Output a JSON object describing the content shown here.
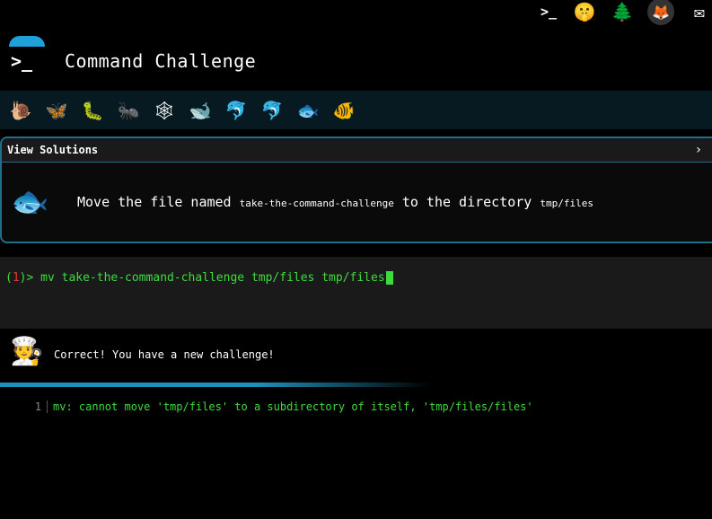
{
  "header": {
    "title": "Command Challenge",
    "top_icons": [
      "prompt-icon",
      "shushing-face-icon",
      "tree-icon",
      "gitlab-icon",
      "mail-icon"
    ],
    "prompt_glyph": ">_"
  },
  "levels": {
    "items": [
      "snail",
      "butterfly",
      "caterpillar",
      "ant",
      "spider-web",
      "whale",
      "dolphin-blue",
      "dolphin-grey",
      "fish",
      "tropical-fish"
    ],
    "active_index": 8
  },
  "solutions_panel": {
    "label": "View Solutions",
    "chevron": "›"
  },
  "challenge": {
    "text_1": "Move the file named ",
    "code_1": "take-the-command-challenge",
    "text_2": " to the directory ",
    "code_2": "tmp/files"
  },
  "terminal": {
    "prompt_open": "(",
    "prompt_num": "1",
    "prompt_close": ")>",
    "command": " mv take-the-command-challenge tmp/files tmp/files"
  },
  "feedback": {
    "message": "Correct! You have a new challenge!"
  },
  "output": {
    "line_number": "1",
    "text": "mv: cannot move 'tmp/files' to a subdirectory of itself, 'tmp/files/files'"
  },
  "colors": {
    "accent": "#1fa0d8",
    "terminal_green": "#3ddc3d",
    "prompt_red": "#e53935"
  }
}
